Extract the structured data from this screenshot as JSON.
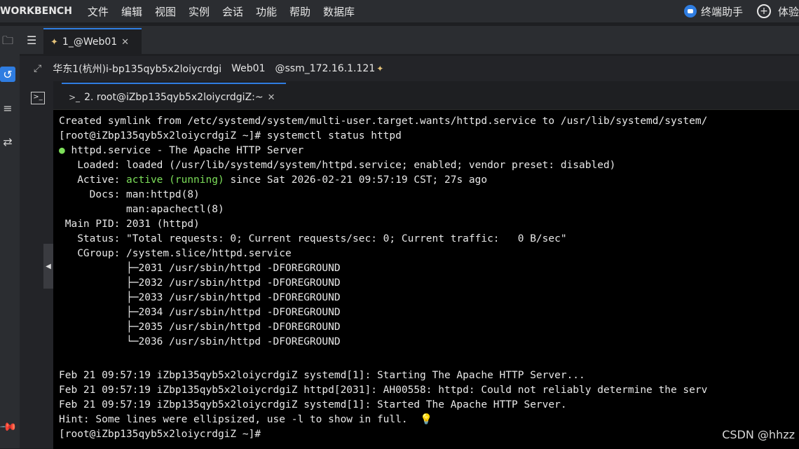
{
  "menubar": {
    "brand": "WORKBENCH",
    "items": [
      "文件",
      "编辑",
      "视图",
      "实例",
      "会话",
      "功能",
      "帮助",
      "数据库"
    ],
    "assistant_label": "终端助手",
    "experience_label": "体验"
  },
  "tabs": {
    "session_tab": "1_@Web01",
    "terminal_tab": "2. root@iZbp135qyb5x2loiycrdgiZ:~"
  },
  "hostbar": {
    "region": "华东1(杭州)i-bp135qyb5x2loiycrdgi",
    "host": "Web01",
    "connection": "@ssm_172.16.1.121"
  },
  "terminal_lines": [
    "Created symlink from /etc/systemd/system/multi-user.target.wants/httpd.service to /usr/lib/systemd/system/",
    "[root@iZbp135qyb5x2loiycrdgiZ ~]# systemctl status httpd",
    "httpd.service - The Apache HTTP Server",
    "   Loaded: loaded (/usr/lib/systemd/system/httpd.service; enabled; vendor preset: disabled)",
    "   Active: ",
    "active (running)",
    " since Sat 2026-02-21 09:57:19 CST; 27s ago",
    "     Docs: man:httpd(8)",
    "           man:apachectl(8)",
    " Main PID: 2031 (httpd)",
    "   Status: \"Total requests: 0; Current requests/sec: 0; Current traffic:   0 B/sec\"",
    "   CGroup: /system.slice/httpd.service",
    "           ├─2031 /usr/sbin/httpd -DFOREGROUND",
    "           ├─2032 /usr/sbin/httpd -DFOREGROUND",
    "           ├─2033 /usr/sbin/httpd -DFOREGROUND",
    "           ├─2034 /usr/sbin/httpd -DFOREGROUND",
    "           ├─2035 /usr/sbin/httpd -DFOREGROUND",
    "           └─2036 /usr/sbin/httpd -DFOREGROUND",
    "Feb 21 09:57:19 iZbp135qyb5x2loiycrdgiZ systemd[1]: Starting The Apache HTTP Server...",
    "Feb 21 09:57:19 iZbp135qyb5x2loiycrdgiZ httpd[2031]: AH00558: httpd: Could not reliably determine the serv",
    "Feb 21 09:57:19 iZbp135qyb5x2loiycrdgiZ systemd[1]: Started The Apache HTTP Server.",
    "Hint: Some lines were ellipsized, use -l to show in full.",
    "[root@iZbp135qyb5x2loiycrdgiZ ~]#"
  ],
  "watermark": "CSDN @hhzz",
  "colors": {
    "accent": "#2f7de1",
    "running": "#7ddf5a"
  }
}
